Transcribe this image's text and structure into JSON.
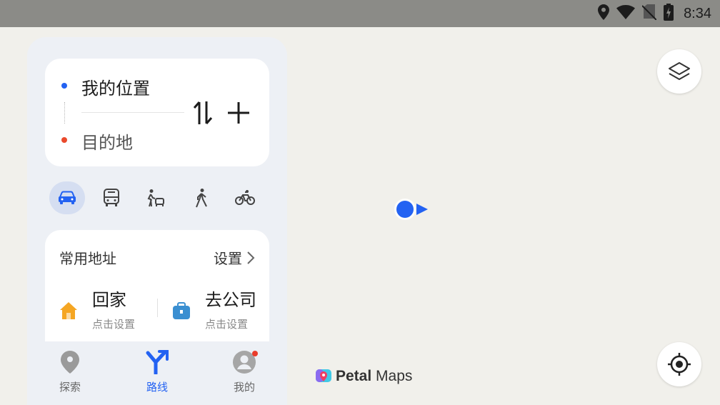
{
  "status_bar": {
    "time": "8:34",
    "icons": [
      "location-icon",
      "wifi-icon",
      "no-sim-icon",
      "battery-icon"
    ]
  },
  "route": {
    "origin": "我的位置",
    "destination": "目的地"
  },
  "transport_modes": [
    {
      "name": "car-icon",
      "active": true
    },
    {
      "name": "bus-icon",
      "active": false
    },
    {
      "name": "taxi-icon",
      "active": false
    },
    {
      "name": "walk-icon",
      "active": false
    },
    {
      "name": "bike-icon",
      "active": false
    }
  ],
  "common_addresses": {
    "title": "常用地址",
    "setting_label": "设置",
    "home": {
      "name": "回家",
      "sub": "点击设置"
    },
    "work": {
      "name": "去公司",
      "sub": "点击设置"
    }
  },
  "nav": {
    "explore": "探索",
    "route": "路线",
    "me": "我的"
  },
  "logo": {
    "bold": "Petal",
    "regular": " Maps"
  },
  "colors": {
    "accent": "#2362f2",
    "destination": "#ea4a2c",
    "home": "#f5a623",
    "work": "#3a8fd1"
  }
}
